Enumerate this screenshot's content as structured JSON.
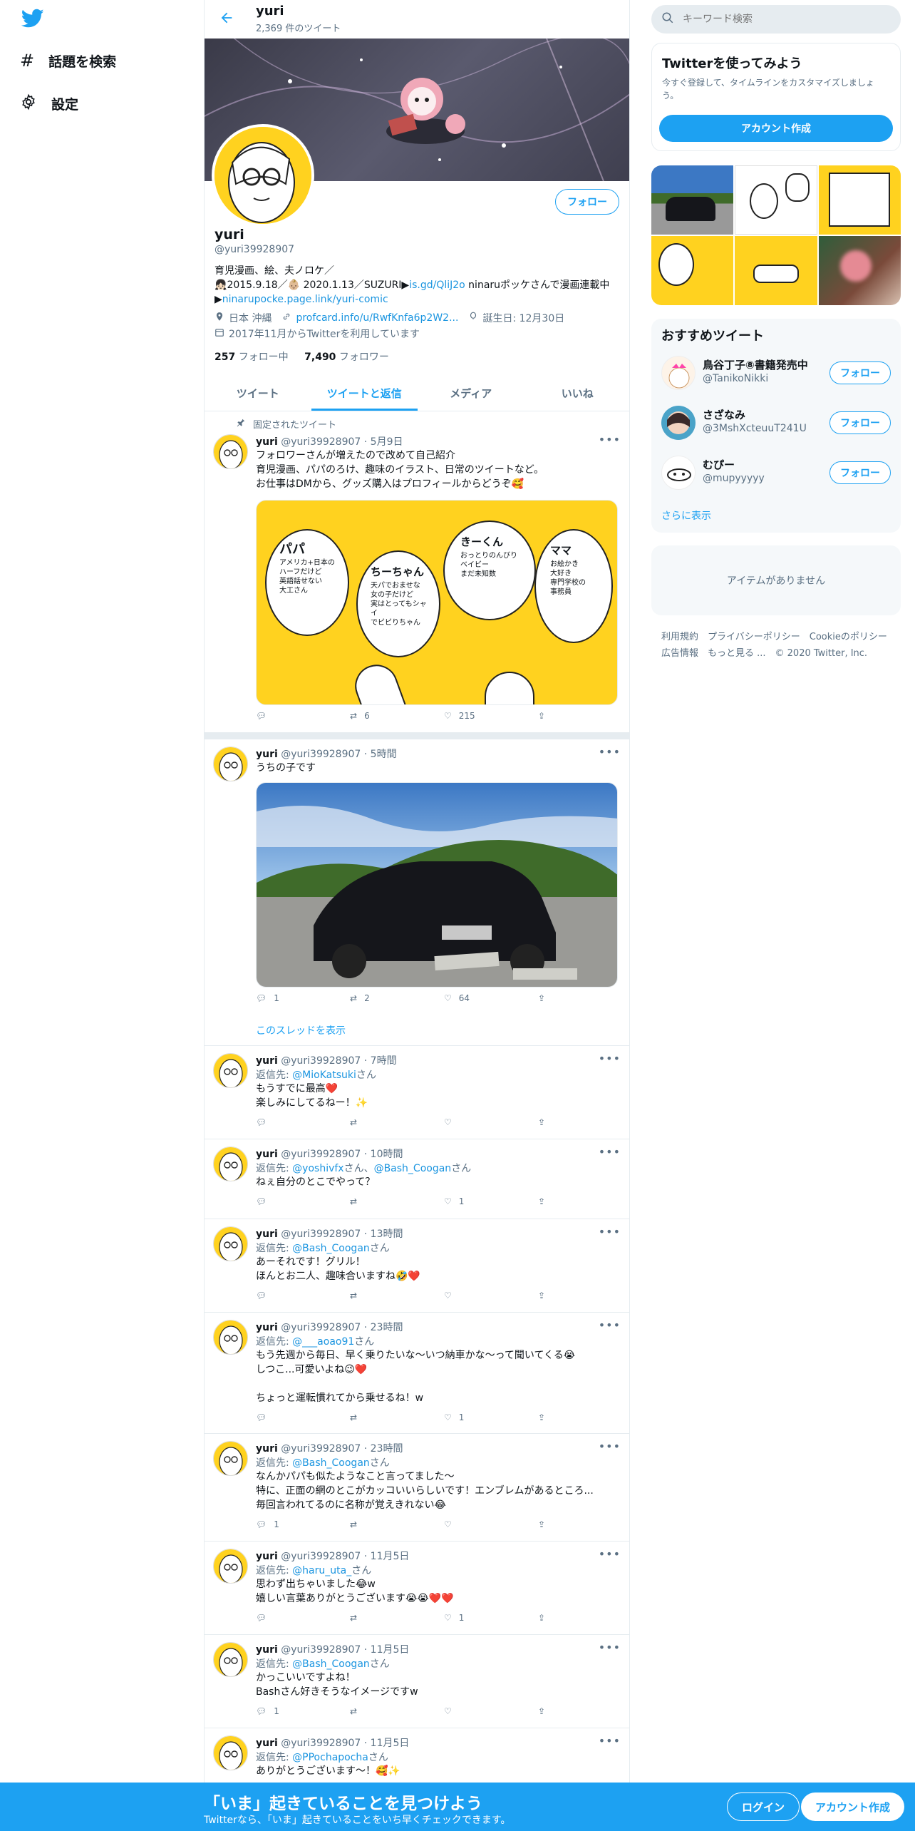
{
  "nav": {
    "explore_label": "話題を検索",
    "settings_label": "設定"
  },
  "header": {
    "name": "yuri",
    "tweet_count": "2,369 件のツイート"
  },
  "profile": {
    "follow_label": "フォロー",
    "name": "yuri",
    "handle": "@yuri39928907",
    "bio_line1": "育児漫画、絵、夫ノロケ／",
    "bio_line2_prefix": "2015.9.18／",
    "bio_line2_mid": "2020.1.13／SUZURI▶",
    "bio_link1": "is.gd/QliJ2o",
    "bio_line2_suffix": " ninaruポッケさんで漫画連載中",
    "bio_line3_prefix": "▶",
    "bio_link2": "ninarupocke.page.link/yuri-comic",
    "location": "日本 沖縄",
    "website": "profcard.info/u/RwfKnfa6p2W2...",
    "birthday": "誕生日: 12月30日",
    "joined": "2017年11月からTwitterを利用しています",
    "following_count": "257",
    "following_label": "フォロー中",
    "followers_count": "7,490",
    "followers_label": "フォロワー"
  },
  "tabs": [
    {
      "label": "ツイート"
    },
    {
      "label": "ツイートと返信"
    },
    {
      "label": "メディア"
    },
    {
      "label": "いいね"
    }
  ],
  "pinned_label": "固定されたツイート",
  "tweets": [
    {
      "name": "yuri",
      "handle": "@yuri39928907",
      "time": "5月9日",
      "text": "フォロワーさんが増えたので改めて自己紹介\n育児漫画、パパのろけ、趣味のイラスト、日常のツイートなど。\nお仕事はDMから、グッズ購入はプロフィールからどうぞ🥰",
      "retweets": "6",
      "likes": "215",
      "image_bubbles": [
        {
          "title": "パパ",
          "lines": [
            "アメリカ+日本の",
            "ハーフだけど",
            "英語話せない",
            "大工さん"
          ]
        },
        {
          "title": "ちーちゃん",
          "lines": [
            "天パでおませな",
            "女の子だけど",
            "実はとってもシャイ",
            "でビビりちゃん"
          ]
        },
        {
          "title": "きーくん",
          "lines": [
            "おっとりのんびり",
            "ベイビー",
            "まだ未知数"
          ]
        },
        {
          "title": "ママ",
          "lines": [
            "お絵かき",
            "大好き",
            "専門学校の",
            "事務員"
          ]
        }
      ]
    },
    {
      "name": "yuri",
      "handle": "@yuri39928907",
      "time": "5時間",
      "text": "うちの子です",
      "replies": "1",
      "retweets": "2",
      "likes": "64",
      "thread_link": "このスレッドを表示"
    },
    {
      "name": "yuri",
      "handle": "@yuri39928907",
      "time": "7時間",
      "reply_prefix": "返信先: ",
      "reply_to": "@MioKatsuki",
      "reply_suffix": "さん",
      "text": "もうすでに最高❤️\n楽しみにしてるねー！✨"
    },
    {
      "name": "yuri",
      "handle": "@yuri39928907",
      "time": "10時間",
      "reply_prefix": "返信先: ",
      "reply_to": "@yoshivfx",
      "reply_mid": "さん、",
      "reply_to2": "@Bash_Coogan",
      "reply_suffix": "さん",
      "text": "ねぇ自分のとこでやって？",
      "likes": "1"
    },
    {
      "name": "yuri",
      "handle": "@yuri39928907",
      "time": "13時間",
      "reply_prefix": "返信先: ",
      "reply_to": "@Bash_Coogan",
      "reply_suffix": "さん",
      "text": "あーそれです！グリル！\nほんとお二人、趣味合いますね🤣❤️"
    },
    {
      "name": "yuri",
      "handle": "@yuri39928907",
      "time": "23時間",
      "reply_prefix": "返信先: ",
      "reply_to": "@___aoao91",
      "reply_suffix": "さん",
      "text": "もう先週から毎日、早く乗りたいな〜いつ納車かな〜って聞いてくる😭\nしつこ...可愛いよね😉❤️\n\nちょっと運転慣れてから乗せるね！w",
      "likes": "1"
    },
    {
      "name": "yuri",
      "handle": "@yuri39928907",
      "time": "23時間",
      "reply_prefix": "返信先: ",
      "reply_to": "@Bash_Coogan",
      "reply_suffix": "さん",
      "text": "なんかパパも似たようなこと言ってました〜\n特に、正面の網のとこがカッコいいらしいです！エンブレムがあるところ...\n毎回言われてるのに名称が覚えきれない😂",
      "replies": "1"
    },
    {
      "name": "yuri",
      "handle": "@yuri39928907",
      "time": "11月5日",
      "reply_prefix": "返信先: ",
      "reply_to": "@haru_uta_",
      "reply_suffix": "さん",
      "text": "思わず出ちゃいました😂w\n嬉しい言葉ありがとうございます😭😭❤️❤️",
      "likes": "1"
    },
    {
      "name": "yuri",
      "handle": "@yuri39928907",
      "time": "11月5日",
      "reply_prefix": "返信先: ",
      "reply_to": "@Bash_Coogan",
      "reply_suffix": "さん",
      "text": "かっこいいですよね！\nBashさん好きそうなイメージですw",
      "replies": "1"
    },
    {
      "name": "yuri",
      "handle": "@yuri39928907",
      "time": "11月5日",
      "reply_prefix": "返信先: ",
      "reply_to": "@PPochapocha",
      "reply_suffix": "さん",
      "text": "ありがとうございます〜！🥰✨"
    }
  ],
  "sidebar": {
    "search_placeholder": "キーワード検索",
    "signup_title": "Twitterを使ってみよう",
    "signup_desc": "今すぐ登録して、タイムラインをカスタマイズしましょう。",
    "signup_button": "アカウント作成",
    "rec_title": "おすすめツイート",
    "recs": [
      {
        "name": "鳥谷丁子⑧書籍発売中",
        "handle": "@TanikoNikki",
        "follow": "フォロー"
      },
      {
        "name": "さざなみ",
        "handle": "@3MshXcteuuT241U",
        "follow": "フォロー"
      },
      {
        "name": "むぴー",
        "handle": "@mupyyyyy",
        "follow": "フォロー"
      }
    ],
    "show_more": "さらに表示",
    "trends_empty": "アイテムがありません",
    "footer_line1": "利用規約　プライバシーポリシー　Cookieのポリシー",
    "footer_line2": "広告情報　もっと見る ...　© 2020 Twitter, Inc."
  },
  "bottom": {
    "title": "「いま」起きていることを見つけよう",
    "subtitle": "Twitterなら、「いま」起きていることをいち早くチェックできます。",
    "login": "ログイン",
    "signup": "アカウント作成"
  },
  "colors": {
    "accent": "#1da1f2",
    "border": "#e6ecf0",
    "muted": "#5b7083",
    "avatar_yellow": "#ffd21f"
  }
}
